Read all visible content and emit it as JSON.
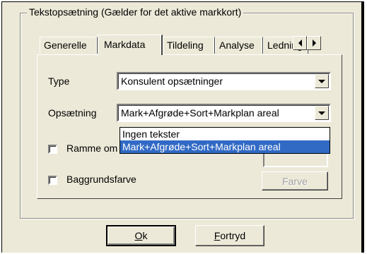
{
  "group": {
    "title": "Tekstopsætning  (Gælder for det aktive markkort)"
  },
  "tabs": [
    {
      "label": "Generelle",
      "active": false
    },
    {
      "label": "Markdata",
      "active": true
    },
    {
      "label": "Tildeling",
      "active": false
    },
    {
      "label": "Analyse",
      "active": false
    },
    {
      "label": "Ledning",
      "active": false
    }
  ],
  "tab_scroll": {
    "left_icon": "triangle-left",
    "right_icon": "triangle-right"
  },
  "form": {
    "type_label": "Type",
    "type_value": "Konsulent opsætninger",
    "opsaetning_label": "Opsætning",
    "opsaetning_value": "Mark+Afgrøde+Sort+Markplan areal",
    "dropdown_options": [
      "Ingen tekster",
      "Mark+Afgrøde+Sort+Markplan areal"
    ],
    "dropdown_selected_index": 1,
    "ramme_label": "Ramme om",
    "ramme_checked": false,
    "baggrund_label": "Baggrundsfarve",
    "baggrund_checked": false,
    "farve_button": "Farve"
  },
  "buttons": {
    "ok_mnemonic": "O",
    "ok_rest": "k",
    "cancel_mnemonic": "F",
    "cancel_rest": "ortryd"
  },
  "colors": {
    "dialog_bg": "#ece9d8",
    "selection": "#316ac5"
  }
}
